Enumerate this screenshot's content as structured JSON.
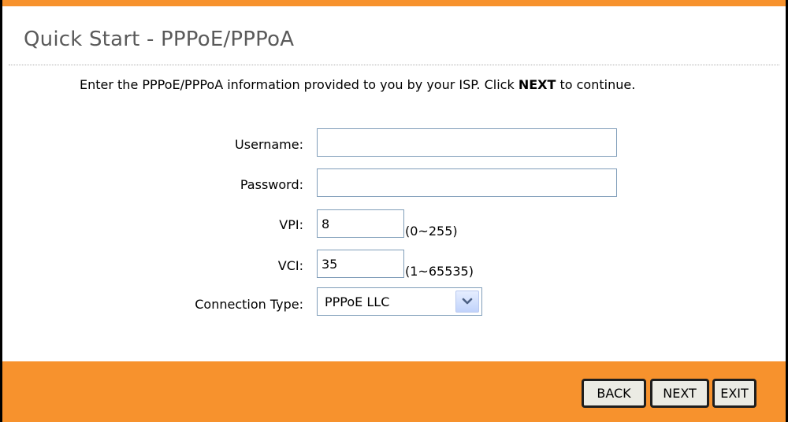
{
  "page": {
    "title": "Quick Start - PPPoE/PPPoA",
    "intro_before": "Enter the PPPoE/PPPoA information provided to you by your ISP. Click ",
    "intro_bold": "NEXT",
    "intro_after": " to continue."
  },
  "form": {
    "username_label": "Username:",
    "username_value": "",
    "password_label": "Password:",
    "password_value": "",
    "vpi_label": "VPI:",
    "vpi_value": "8",
    "vpi_range": "(0~255)",
    "vci_label": "VCI:",
    "vci_value": "35",
    "vci_range": "(1~65535)",
    "connection_type_label": "Connection Type:",
    "connection_type_value": "PPPoE LLC"
  },
  "buttons": {
    "back": "BACK",
    "next": "NEXT",
    "exit": "EXIT"
  },
  "colors": {
    "accent_orange": "#f7922d",
    "title_gray": "#5a5a5a"
  },
  "icons": {
    "dropdown": "chevron-down-icon"
  }
}
